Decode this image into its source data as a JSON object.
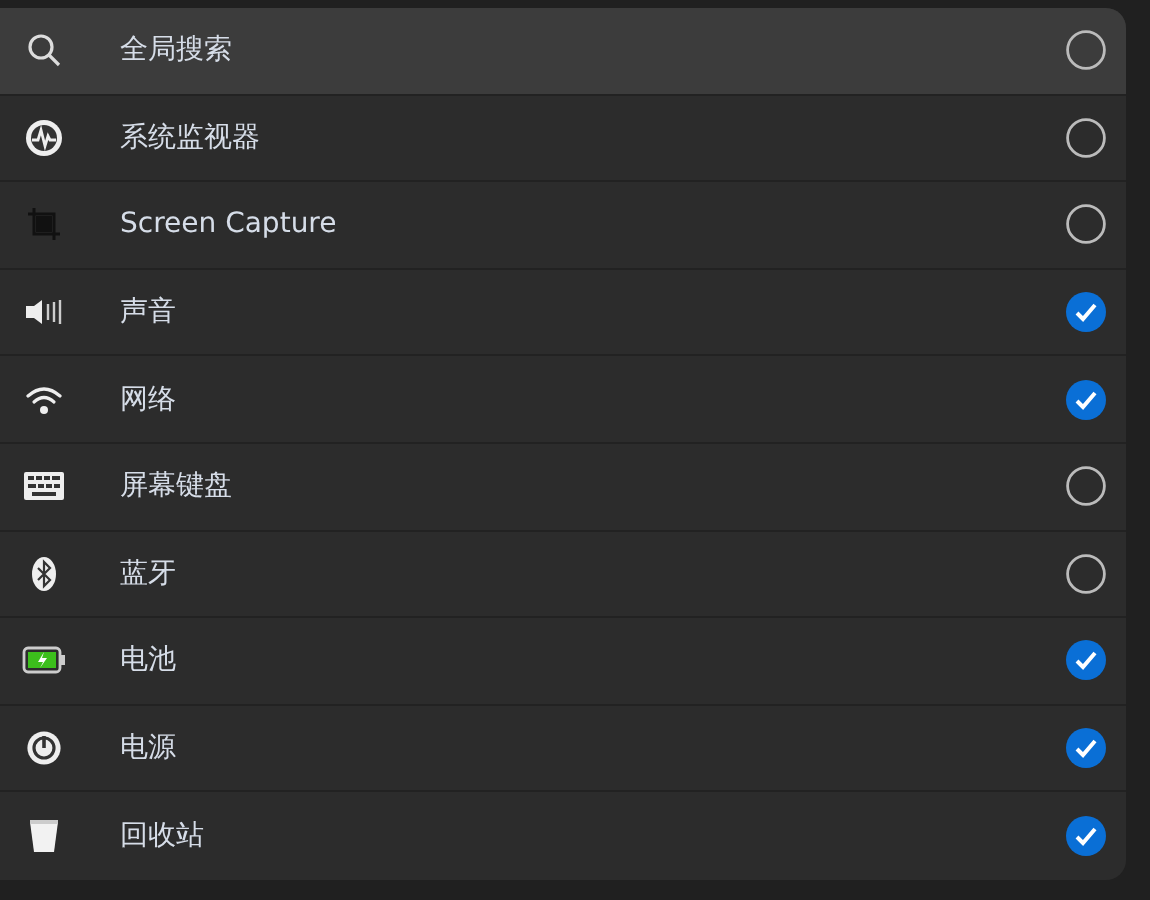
{
  "items": [
    {
      "label": "全局搜索",
      "selected": true,
      "checked": false
    },
    {
      "label": "系统监视器",
      "selected": false,
      "checked": false
    },
    {
      "label": "Screen Capture",
      "selected": false,
      "checked": false
    },
    {
      "label": "声音",
      "selected": false,
      "checked": true
    },
    {
      "label": "网络",
      "selected": false,
      "checked": true
    },
    {
      "label": "屏幕键盘",
      "selected": false,
      "checked": false
    },
    {
      "label": "蓝牙",
      "selected": false,
      "checked": false
    },
    {
      "label": "电池",
      "selected": false,
      "checked": true
    },
    {
      "label": "电源",
      "selected": false,
      "checked": true
    },
    {
      "label": "回收站",
      "selected": false,
      "checked": true
    }
  ]
}
